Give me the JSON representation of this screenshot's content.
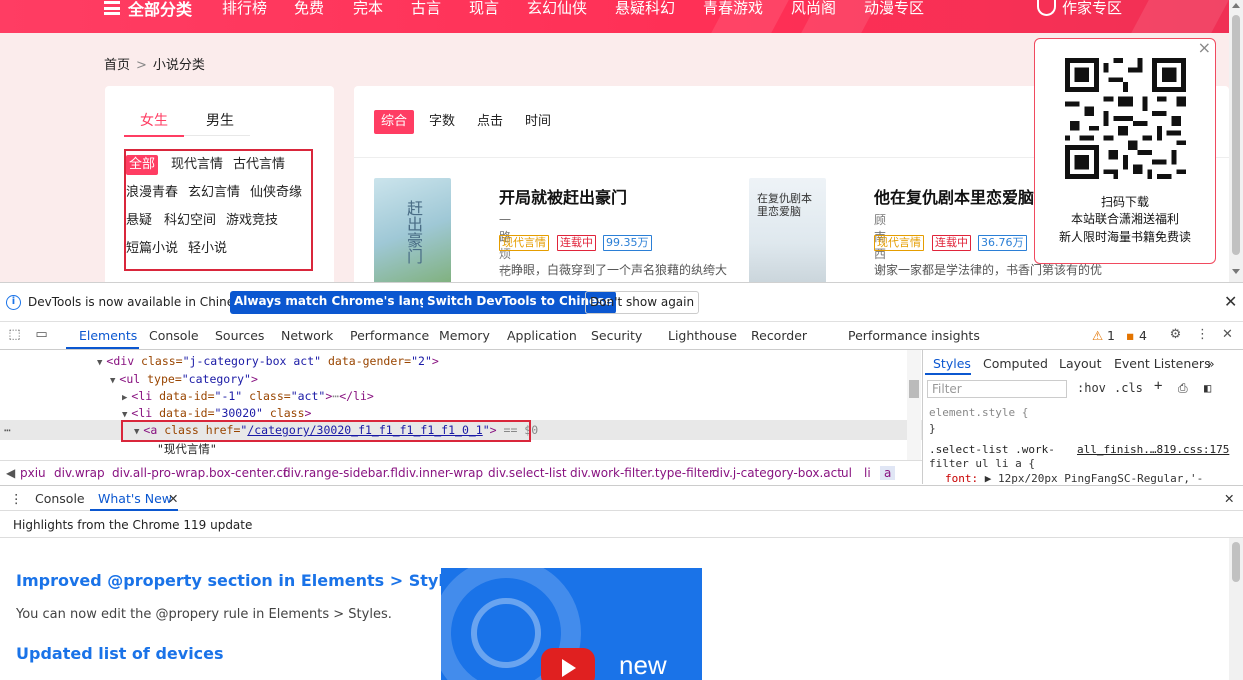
{
  "topnav": {
    "all_label": "全部分类",
    "items": [
      "排行榜",
      "免费",
      "完本",
      "古言",
      "现言",
      "玄幻仙侠",
      "悬疑科幻",
      "青春游戏",
      "风尚阁",
      "动漫专区"
    ],
    "author_label": "作家专区"
  },
  "breadcrumb": {
    "home": "首页",
    "sep": ">",
    "current": "小说分类"
  },
  "sidebar": {
    "gender_tabs": [
      "女生",
      "男生"
    ],
    "categories": [
      "全部",
      "现代言情",
      "古代言情",
      "浪漫青春",
      "玄幻言情",
      "仙侠奇缘",
      "悬疑",
      "科幻空间",
      "游戏竞技",
      "短篇小说",
      "轻小说"
    ]
  },
  "main": {
    "sort_tabs": [
      "综合",
      "字数",
      "点击",
      "时间"
    ],
    "books": [
      {
        "cover_text": "赶出豪门",
        "title": "开局就被赶出豪门",
        "author": "一路烦花",
        "tags": [
          "现代言情",
          "连载中",
          "99.35万"
        ],
        "desc": "一睁眼，白薇穿到了一个声名狼藉的纨绔大"
      },
      {
        "cover_text": "在复仇剧本里恋爱脑",
        "title": "他在复仇剧本里恋爱脑",
        "author": "顾南西",
        "tags": [
          "现代言情",
          "连载中",
          "36.76万"
        ],
        "desc": "谢家一家都是学法律的，书香门第该有的优"
      }
    ]
  },
  "qr_popup": {
    "close": "×",
    "line1": "扫码下载",
    "line2": "本站联合潇湘送福利",
    "line3": "新人限时海量书籍免费读"
  },
  "devtools": {
    "info_message": "DevTools is now available in Chinese!",
    "btn_match": "Always match Chrome's language",
    "btn_switch": "Switch DevTools to Chinese",
    "btn_dont": "Don't show again",
    "tabs": [
      "Elements",
      "Console",
      "Sources",
      "Network",
      "Performance",
      "Memory",
      "Application",
      "Security",
      "Lighthouse",
      "Recorder",
      "Performance insights"
    ],
    "warn_count": "1",
    "issue_count": "4",
    "elements": {
      "line1_tag": "<div ",
      "line1_attr": "class=",
      "line1_val": "\"j-category-box act\"",
      "line1_attr2": " data-gender=",
      "line1_val2": "\"2\"",
      "line1_end": ">",
      "line2_tag": "<ul ",
      "line2_attr": "type=",
      "line2_val": "\"category\"",
      "line2_end": ">",
      "line3_tag": "<li ",
      "line3_attr": "data-id=",
      "line3_val": "\"-1\"",
      "line3_attr2": " class=",
      "line3_val2": "\"act\"",
      "line3_end": ">",
      "line3_ell": "⋯",
      "line3_close": "</li>",
      "line4_tag": "<li ",
      "line4_attr": "data-id=",
      "line4_val": "\"30020\"",
      "line4_attr2": " class",
      "line4_end": ">",
      "line5_tag": "<a ",
      "line5_attr": "class href=",
      "line5_q1": "\"",
      "line5_link": "/category/30020_f1_f1_f1_f1_f1_0_1",
      "line5_q2": "\"",
      "line5_end": ">",
      "line5_eq": " == $0",
      "line6_text": "\"现代言情\"",
      "dots": "⋯"
    },
    "crumbs": [
      "pxiu",
      "div.wrap",
      "div.all-pro-wrap.box-center.cf",
      "div.range-sidebar.fl",
      "div.inner-wrap",
      "div.select-list",
      "div.work-filter.type-filter",
      "div.j-category-box.act",
      "ul",
      "li",
      "a"
    ],
    "styles_tabs": [
      "Styles",
      "Computed",
      "Layout",
      "Event Listeners"
    ],
    "filter_placeholder": "Filter",
    "hov": ":hov",
    "cls": ".cls",
    "style_lines": {
      "element_style": "element.style {",
      "close_brace": "}",
      "rule_selector1": ".select-list .work-",
      "rule_source": "all_finish.…819.css:175",
      "rule_selector2": "filter ul li a {",
      "font_prop": "font:",
      "font_val": " ▶ 12px/20px PingFangSC-Regular,'-"
    },
    "drawer_tabs": [
      "Console",
      "What's New"
    ],
    "highlights": "Highlights from the Chrome 119 update",
    "whatsnew": {
      "h1": "Improved @property section in Elements > Styles",
      "p1": "You can now edit the @propery rule in Elements > Styles.",
      "h2": "Updated list of devices",
      "promo_word": "new"
    }
  },
  "colors": {
    "accent": "#ff3d63",
    "devtools_blue": "#0b57d0"
  }
}
